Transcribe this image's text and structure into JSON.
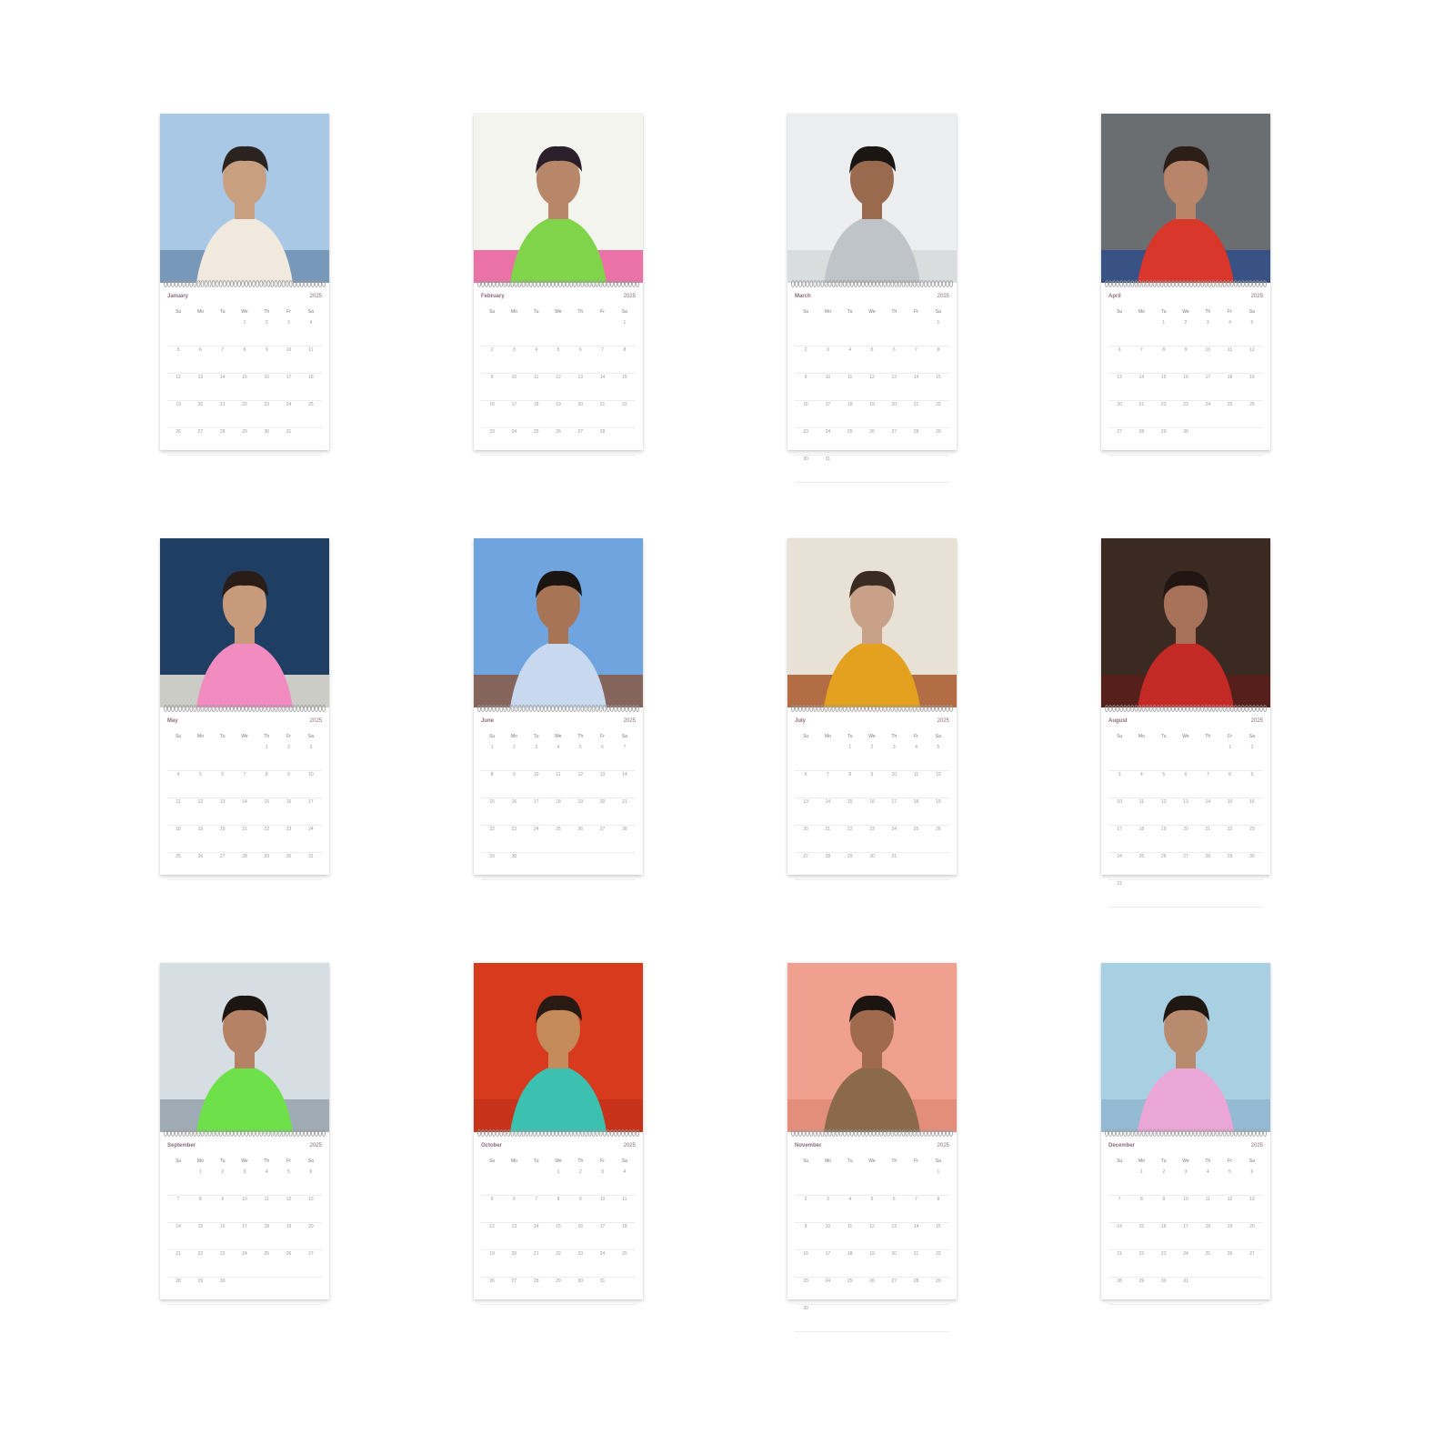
{
  "calendar_year": "2025",
  "weekdays": [
    "Su",
    "Mo",
    "Tu",
    "We",
    "Th",
    "Fr",
    "Sa"
  ],
  "months": [
    {
      "label": "January",
      "weeks": [
        [
          "",
          "",
          "",
          "1",
          "2",
          "3",
          "4"
        ],
        [
          "5",
          "6",
          "7",
          "8",
          "9",
          "10",
          "11"
        ],
        [
          "12",
          "13",
          "14",
          "15",
          "16",
          "17",
          "18"
        ],
        [
          "19",
          "20",
          "21",
          "22",
          "23",
          "24",
          "25"
        ],
        [
          "26",
          "27",
          "28",
          "29",
          "30",
          "31",
          ""
        ]
      ],
      "photo_colors": {
        "bg": "#a9c8e6",
        "accent": "#f1e9dd",
        "figure": "#c9a07f",
        "hair": "#2b2320",
        "floor": "#6e8fb0"
      }
    },
    {
      "label": "February",
      "weeks": [
        [
          "",
          "",
          "",
          "",
          "",
          "",
          "1"
        ],
        [
          "2",
          "3",
          "4",
          "5",
          "6",
          "7",
          "8"
        ],
        [
          "9",
          "10",
          "11",
          "12",
          "13",
          "14",
          "15"
        ],
        [
          "16",
          "17",
          "18",
          "19",
          "20",
          "21",
          "22"
        ],
        [
          "23",
          "24",
          "25",
          "26",
          "27",
          "28",
          ""
        ]
      ],
      "photo_colors": {
        "bg": "#f4f4ef",
        "accent": "#7fd44a",
        "figure": "#b8876a",
        "hair": "#2a1f2a",
        "floor": "#e85a9a"
      }
    },
    {
      "label": "March",
      "weeks": [
        [
          "",
          "",
          "",
          "",
          "",
          "",
          "1"
        ],
        [
          "2",
          "3",
          "4",
          "5",
          "6",
          "7",
          "8"
        ],
        [
          "9",
          "10",
          "11",
          "12",
          "13",
          "14",
          "15"
        ],
        [
          "16",
          "17",
          "18",
          "19",
          "20",
          "21",
          "22"
        ],
        [
          "23",
          "24",
          "25",
          "26",
          "27",
          "28",
          "29"
        ],
        [
          "30",
          "31",
          "",
          "",
          "",
          "",
          ""
        ]
      ],
      "photo_colors": {
        "bg": "#eceef0",
        "accent": "#bfc4c8",
        "figure": "#9a6a4f",
        "hair": "#1a1614",
        "floor": "#d7d9db"
      }
    },
    {
      "label": "April",
      "weeks": [
        [
          "",
          "",
          "1",
          "2",
          "3",
          "4",
          "5"
        ],
        [
          "6",
          "7",
          "8",
          "9",
          "10",
          "11",
          "12"
        ],
        [
          "13",
          "14",
          "15",
          "16",
          "17",
          "18",
          "19"
        ],
        [
          "20",
          "21",
          "22",
          "23",
          "24",
          "25",
          "26"
        ],
        [
          "27",
          "28",
          "29",
          "30",
          "",
          "",
          ""
        ]
      ],
      "photo_colors": {
        "bg": "#6a6e70",
        "accent": "#d9372c",
        "figure": "#b9856a",
        "hair": "#2b1f18",
        "floor": "#2f4e8a"
      }
    },
    {
      "label": "May",
      "weeks": [
        [
          "",
          "",
          "",
          "",
          "1",
          "2",
          "3"
        ],
        [
          "4",
          "5",
          "6",
          "7",
          "8",
          "9",
          "10"
        ],
        [
          "11",
          "12",
          "13",
          "14",
          "15",
          "16",
          "17"
        ],
        [
          "18",
          "19",
          "20",
          "21",
          "22",
          "23",
          "24"
        ],
        [
          "25",
          "26",
          "27",
          "28",
          "29",
          "30",
          "31"
        ]
      ],
      "photo_colors": {
        "bg": "#1f3e63",
        "accent": "#f28cc0",
        "figure": "#c79a7b",
        "hair": "#2a1d18",
        "floor": "#eae5d6"
      }
    },
    {
      "label": "June",
      "weeks": [
        [
          "1",
          "2",
          "3",
          "4",
          "5",
          "6",
          "7"
        ],
        [
          "8",
          "9",
          "10",
          "11",
          "12",
          "13",
          "14"
        ],
        [
          "15",
          "16",
          "17",
          "18",
          "19",
          "20",
          "21"
        ],
        [
          "22",
          "23",
          "24",
          "25",
          "26",
          "27",
          "28"
        ],
        [
          "29",
          "30",
          "",
          "",
          "",
          "",
          ""
        ]
      ],
      "photo_colors": {
        "bg": "#6fa4df",
        "accent": "#c8d8ee",
        "figure": "#a87456",
        "hair": "#1b1512",
        "floor": "#8a5a44"
      }
    },
    {
      "label": "July",
      "weeks": [
        [
          "",
          "",
          "1",
          "2",
          "3",
          "4",
          "5"
        ],
        [
          "6",
          "7",
          "8",
          "9",
          "10",
          "11",
          "12"
        ],
        [
          "13",
          "14",
          "15",
          "16",
          "17",
          "18",
          "19"
        ],
        [
          "20",
          "21",
          "22",
          "23",
          "24",
          "25",
          "26"
        ],
        [
          "27",
          "28",
          "29",
          "30",
          "31",
          "",
          ""
        ]
      ],
      "photo_colors": {
        "bg": "#e8e2d6",
        "accent": "#e4a11f",
        "figure": "#c9a088",
        "hair": "#3a2c22",
        "floor": "#a8582a"
      }
    },
    {
      "label": "August",
      "weeks": [
        [
          "",
          "",
          "",
          "",
          "",
          "1",
          "2"
        ],
        [
          "3",
          "4",
          "5",
          "6",
          "7",
          "8",
          "9"
        ],
        [
          "10",
          "11",
          "12",
          "13",
          "14",
          "15",
          "16"
        ],
        [
          "17",
          "18",
          "19",
          "20",
          "21",
          "22",
          "23"
        ],
        [
          "24",
          "25",
          "26",
          "27",
          "28",
          "29",
          "30"
        ],
        [
          "31",
          "",
          "",
          "",
          "",
          "",
          ""
        ]
      ],
      "photo_colors": {
        "bg": "#3a2a22",
        "accent": "#c32a25",
        "figure": "#a77259",
        "hair": "#211611",
        "floor": "#5a1e1a"
      }
    },
    {
      "label": "September",
      "weeks": [
        [
          "",
          "1",
          "2",
          "3",
          "4",
          "5",
          "6"
        ],
        [
          "7",
          "8",
          "9",
          "10",
          "11",
          "12",
          "13"
        ],
        [
          "14",
          "15",
          "16",
          "17",
          "18",
          "19",
          "20"
        ],
        [
          "21",
          "22",
          "23",
          "24",
          "25",
          "26",
          "27"
        ],
        [
          "28",
          "29",
          "30",
          "",
          "",
          "",
          ""
        ]
      ],
      "photo_colors": {
        "bg": "#d6dde3",
        "accent": "#6ee04a",
        "figure": "#b68266",
        "hair": "#1c1511",
        "floor": "#97a3ad"
      }
    },
    {
      "label": "October",
      "weeks": [
        [
          "",
          "",
          "",
          "1",
          "2",
          "3",
          "4"
        ],
        [
          "5",
          "6",
          "7",
          "8",
          "9",
          "10",
          "11"
        ],
        [
          "12",
          "13",
          "14",
          "15",
          "16",
          "17",
          "18"
        ],
        [
          "19",
          "20",
          "21",
          "22",
          "23",
          "24",
          "25"
        ],
        [
          "26",
          "27",
          "28",
          "29",
          "30",
          "31",
          ""
        ]
      ],
      "photo_colors": {
        "bg": "#d83a1e",
        "accent": "#3cc0b0",
        "figure": "#c48a5a",
        "hair": "#2a1a14",
        "floor": "#c3321a"
      }
    },
    {
      "label": "November",
      "weeks": [
        [
          "",
          "",
          "",
          "",
          "",
          "",
          "1"
        ],
        [
          "2",
          "3",
          "4",
          "5",
          "6",
          "7",
          "8"
        ],
        [
          "9",
          "10",
          "11",
          "12",
          "13",
          "14",
          "15"
        ],
        [
          "16",
          "17",
          "18",
          "19",
          "20",
          "21",
          "22"
        ],
        [
          "23",
          "24",
          "25",
          "26",
          "27",
          "28",
          "29"
        ],
        [
          "30",
          "",
          "",
          "",
          "",
          "",
          ""
        ]
      ],
      "photo_colors": {
        "bg": "#f0a08e",
        "accent": "#8a6a4a",
        "figure": "#a06a4e",
        "hair": "#1b1410",
        "floor": "#e08a78"
      }
    },
    {
      "label": "December",
      "weeks": [
        [
          "",
          "1",
          "2",
          "3",
          "4",
          "5",
          "6"
        ],
        [
          "7",
          "8",
          "9",
          "10",
          "11",
          "12",
          "13"
        ],
        [
          "14",
          "15",
          "16",
          "17",
          "18",
          "19",
          "20"
        ],
        [
          "21",
          "22",
          "23",
          "24",
          "25",
          "26",
          "27"
        ],
        [
          "28",
          "29",
          "30",
          "31",
          "",
          "",
          ""
        ]
      ],
      "photo_colors": {
        "bg": "#a9d0e2",
        "accent": "#e9a6d6",
        "figure": "#b88a6e",
        "hair": "#1f1712",
        "floor": "#8fb6cf"
      }
    }
  ]
}
